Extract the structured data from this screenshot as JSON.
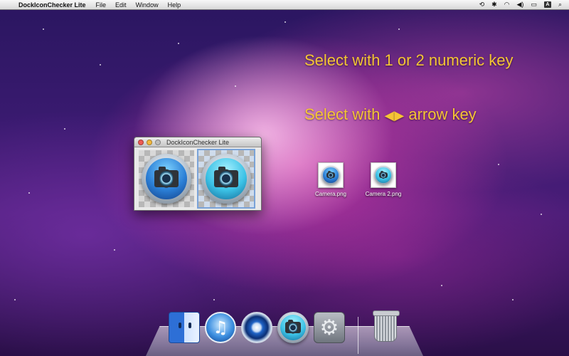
{
  "menubar": {
    "app_name": "DockIconChecker Lite",
    "menus": [
      "File",
      "Edit",
      "Window",
      "Help"
    ],
    "status_icons": [
      "time-machine-icon",
      "bluetooth-icon",
      "wifi-icon",
      "volume-icon",
      "battery-icon",
      "input-menu-icon",
      "spotlight-icon"
    ],
    "input_menu_label": "A"
  },
  "captions": {
    "numeric": "Select with 1 or 2 numeric key",
    "arrow_prefix": "Select with",
    "arrow_suffix": "arrow key",
    "arrow_left": "◀",
    "arrow_right": "▶"
  },
  "window": {
    "title": "DockIconChecker Lite",
    "panes": [
      {
        "icon": "camera-icon",
        "selected": false
      },
      {
        "icon": "camera-icon",
        "selected": true
      }
    ]
  },
  "desktop_files": [
    {
      "label": "Camera.png",
      "icon": "camera-icon"
    },
    {
      "label": "Camera 2.png",
      "icon": "camera-icon"
    }
  ],
  "dock": {
    "items": [
      "finder-icon",
      "itunes-icon",
      "quicktime-icon",
      "camera-icon",
      "system-preferences-icon",
      "trash-icon"
    ],
    "itunes_glyph": "♫",
    "prefs_glyph": "⚙"
  }
}
